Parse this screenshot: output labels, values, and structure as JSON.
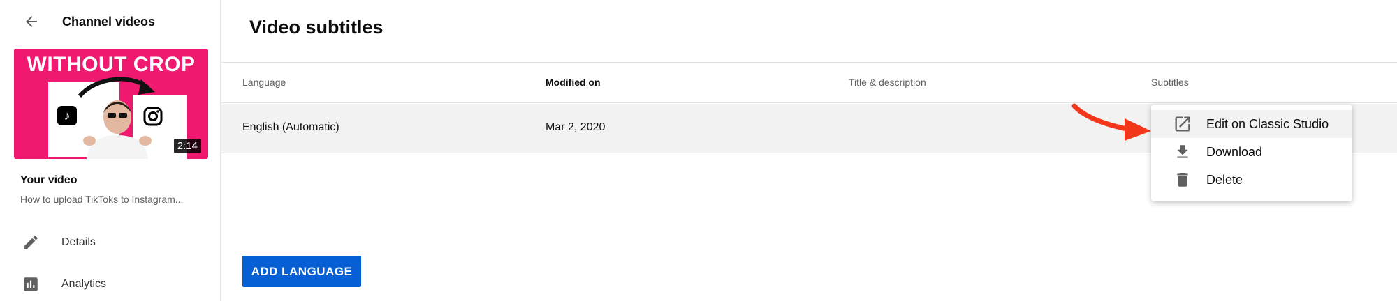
{
  "sidebar": {
    "back_label": "Channel videos",
    "thumbnail": {
      "title": "WITHOUT CROP",
      "duration": "2:14"
    },
    "your_video_label": "Your video",
    "video_title": "How to upload TikToks to Instagram...",
    "nav": [
      {
        "label": "Details",
        "icon": "pencil-icon"
      },
      {
        "label": "Analytics",
        "icon": "analytics-icon"
      }
    ]
  },
  "main": {
    "title": "Video subtitles",
    "table": {
      "headers": [
        "Language",
        "Modified on",
        "Title & description",
        "Subtitles"
      ],
      "rows": [
        {
          "language": "English (Automatic)",
          "modified": "Mar 2, 2020",
          "title_desc": "",
          "subtitles": ""
        }
      ]
    },
    "add_language_label": "ADD LANGUAGE"
  },
  "menu": {
    "items": [
      {
        "label": "Edit on Classic Studio",
        "icon": "open-external-icon"
      },
      {
        "label": "Download",
        "icon": "download-icon"
      },
      {
        "label": "Delete",
        "icon": "trash-icon"
      }
    ]
  },
  "colors": {
    "accent_blue": "#065fd4",
    "thumbnail_pink": "#f0186f",
    "annotation_red": "#f2361a",
    "row_highlight": "#f2f2f2"
  }
}
